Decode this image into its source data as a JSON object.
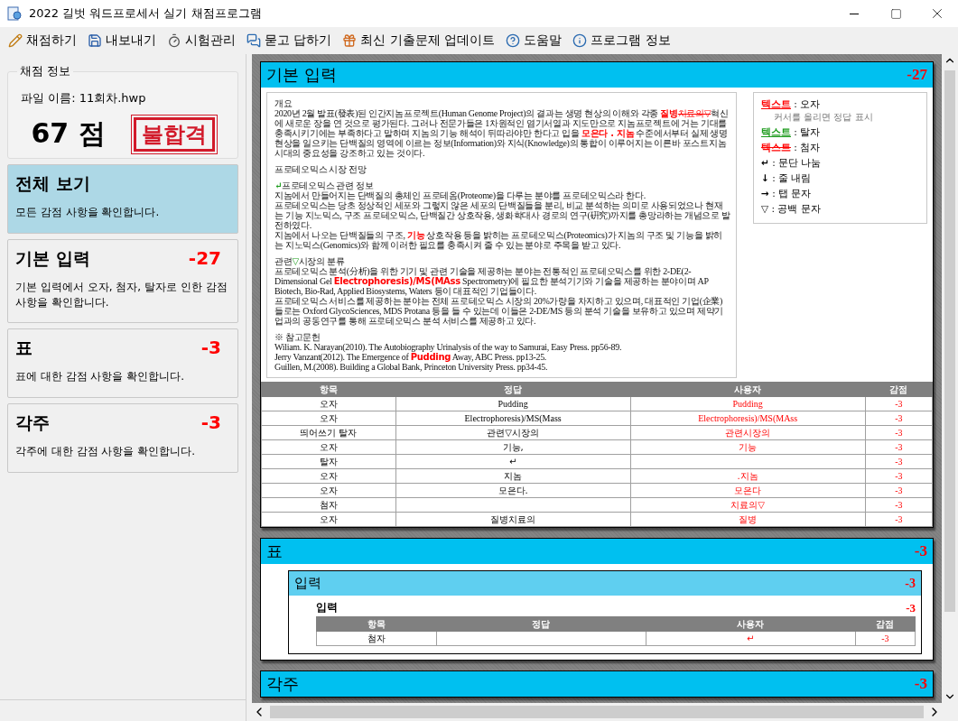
{
  "window": {
    "title": "2022 길벗 워드프로세서 실기 채점프로그램"
  },
  "toolbar": [
    {
      "label": "채점하기"
    },
    {
      "label": "내보내기"
    },
    {
      "label": "시험관리"
    },
    {
      "label": "묻고 답하기"
    },
    {
      "label": "최신 기출문제 업데이트"
    },
    {
      "label": "도움말"
    },
    {
      "label": "프로그램 정보"
    }
  ],
  "sidebar": {
    "group_title": "채점 정보",
    "file_name": "파일 이름: 11회차.hwp",
    "score": "67 점",
    "result": "불합격",
    "cards": [
      {
        "title": "전체 보기",
        "description": "모든 감점 사항을 확인합니다.",
        "selected": true
      },
      {
        "title": "기본 입력",
        "deduction": "-27",
        "description": "기본 입력에서 오자, 첨자, 탈자로 인한 감점 사항을 확인합니다.",
        "selected": false
      },
      {
        "title": "표",
        "deduction": "-3",
        "description": "표에 대한 감점 사항을 확인합니다.",
        "selected": false
      },
      {
        "title": "각주",
        "deduction": "-3",
        "description": "각주에 대한 감점 사항을 확인합니다.",
        "selected": false
      }
    ]
  },
  "sections": [
    {
      "title": "기본 입력",
      "deduction": "-27",
      "document": [
        {
          "spaced": false,
          "segments": [
            "개요"
          ]
        },
        {
          "spaced": false,
          "segments": [
            "2020년 2월 발표(發表)된 인간지놈프로젝트(Human Genome Project)의 결과는 생명 현상의 이해와 각종 ",
            {
              "kind": "error",
              "text": "질병"
            },
            {
              "kind": "extra",
              "text": "치료의▽"
            },
            "혁신에 새로운 장을 연 것으로 평가된다. 그러나 전문가들은 1차원적인 염기서열과 지도만으로 지놈프로젝트에 거는 기대를 충족시키기에는 부족하다고 말하며 지놈의 기능 해석이 뒤따라야만 한다고 입을 ",
            {
              "kind": "error",
              "text": "모은다 . 지놈"
            },
            " 수준에서부터 실제 생명현상을 일으키는 단백질의 영역에 이르는 정보(Information)와 지식(Knowledge)의 통합이 이루어지는 이른바 포스트지놈 시대의 중요성을 강조하고 있는 것이다."
          ]
        },
        {
          "spaced": true,
          "segments": [
            "프로테오믹스 시장 전망"
          ]
        },
        {
          "spaced": true,
          "segments": [
            {
              "kind": "missing",
              "text": "↵"
            },
            "프로테오믹스 관련 정보"
          ]
        },
        {
          "spaced": false,
          "segments": [
            "지놈에서 만들어지는 단백질의 총체인 프로테옴(Proteome)을 다루는 분야를 프로테오믹스라 한다."
          ]
        },
        {
          "spaced": false,
          "segments": [
            "프로테오믹스는 당초 정상적인 세포와 그렇지 않은 세포의 단백질들을 분리, 비교 분석하는 의미로 사용되었으나 현재는 기능 지노믹스, 구조 프로테오믹스, 단백질간 상호작용, 생화학대사 경로의 연구(硏究)까지를 총망라하는 개념으로 발전하였다."
          ]
        },
        {
          "spaced": false,
          "segments": [
            "지놈에서 나오는 단백질들의 구조, ",
            {
              "kind": "error",
              "text": "기능"
            },
            " 상호작용 등을 밝히는 프로테오믹스(Proteomics)가 지놈의 구조 및 기능을 밝히는 지노믹스(Genomics)와 함께 이러한 필요를 충족시켜 줄 수 있는 분야로 주목을 받고 있다."
          ]
        },
        {
          "spaced": true,
          "segments": [
            "관련",
            {
              "kind": "missing",
              "text": "▽"
            },
            "시장의 분류"
          ]
        },
        {
          "spaced": false,
          "segments": [
            "프로테오믹스 분석(分析)을 위한 기기 및 관련 기술을 제공하는 분야는 전통적인 프로테오믹스를 위한 2-DE(2-Dimensional Gel ",
            {
              "kind": "error",
              "text": "Electrophoresis)/MS(MAss"
            },
            " Spectrometry)에 필요한 분석기기와 기술을 제공하는 분야이며 AP Biotech, Bio-Rad, Applied Biosystems, Waters 등이 대표적인 기업들이다."
          ]
        },
        {
          "spaced": false,
          "segments": [
            "프로테오믹스 서비스를 제공하는 분야는 전체 프로테오믹스 시장의 20%가량을 차지하고 있으며, 대표적인 기업(企業)들로는 Oxford GlycoSciences, MDS Protana 등을 들 수 있는데 이들은 2-DE/MS 등의 분석 기술을 보유하고 있으며 제약기업과의 공동연구를 통해 프로테오믹스 분석 서비스를 제공하고 있다."
          ]
        },
        {
          "spaced": true,
          "segments": [
            "※ 참고문헌"
          ]
        },
        {
          "spaced": false,
          "segments": [
            "Wiliam. K. Narayan(2010). The Autobiography Urinalysis of the way to Samurai, Easy Press. pp56-89."
          ]
        },
        {
          "spaced": false,
          "segments": [
            "Jerry Vanzant(2012). The Emergence of ",
            {
              "kind": "error",
              "text": "Pudding"
            },
            " Away, ABC Press. pp13-25."
          ]
        },
        {
          "spaced": false,
          "segments": [
            "Guillen, M.(2008). Building a Global Bank, Princeton University Press. pp34-45."
          ]
        }
      ],
      "legend": [
        {
          "kind": "error",
          "sample": "텍스트",
          "label": ": 오자",
          "note": "커서를 올리면 정답 표시"
        },
        {
          "kind": "missing",
          "sample": "텍스트",
          "label": ": 탈자"
        },
        {
          "kind": "extra",
          "sample": "텍스트",
          "label": ": 첨자"
        },
        {
          "kind": "symbol",
          "sample": "↵",
          "label": ": 문단 나눔"
        },
        {
          "kind": "symbol",
          "sample": "↓",
          "label": ": 줄 내림"
        },
        {
          "kind": "symbol",
          "sample": "→",
          "label": ": 탭 문자"
        },
        {
          "kind": "symbol",
          "sample": "▽",
          "label": ": 공백 문자"
        }
      ],
      "table": {
        "columns": [
          "항목",
          "정답",
          "사용자",
          "감점"
        ],
        "rows": [
          {
            "item": "오자",
            "answer": "Pudding",
            "user": "Pudding",
            "deduction": "-3"
          },
          {
            "item": "오자",
            "answer": "Electrophoresis)/MS(Mass",
            "user": "Electrophoresis)/MS(MAss",
            "deduction": "-3"
          },
          {
            "item": "띄어쓰기 탈자",
            "answer": "관련▽시장의",
            "user": "관련시장의",
            "deduction": "-3"
          },
          {
            "item": "오자",
            "answer": "기능,",
            "user": "기능",
            "deduction": "-3"
          },
          {
            "item": "탈자",
            "answer": "↵",
            "deduction": "-3"
          },
          {
            "item": "오자",
            "answer": "지놈",
            "user": ".지놈",
            "deduction": "-3"
          },
          {
            "item": "오자",
            "answer": "모은다.",
            "user": "모은다",
            "deduction": "-3"
          },
          {
            "item": "첨자",
            "user": "치료의▽",
            "deduction": "-3"
          },
          {
            "item": "오자",
            "answer": "질병치료의",
            "user": "질병",
            "deduction": "-3"
          }
        ]
      }
    },
    {
      "title": "표",
      "deduction": "-3",
      "subsections": [
        {
          "title": "입력",
          "deduction": "-3",
          "groups": [
            {
              "title": "입력",
              "deduction": "-3",
              "table": {
                "columns": [
                  "항목",
                  "정답",
                  "사용자",
                  "감점"
                ],
                "rows": [
                  {
                    "item": "첨자",
                    "user": "↵",
                    "deduction": "-3"
                  }
                ]
              }
            }
          ]
        }
      ]
    },
    {
      "title": "각주",
      "deduction": "-3"
    }
  ]
}
